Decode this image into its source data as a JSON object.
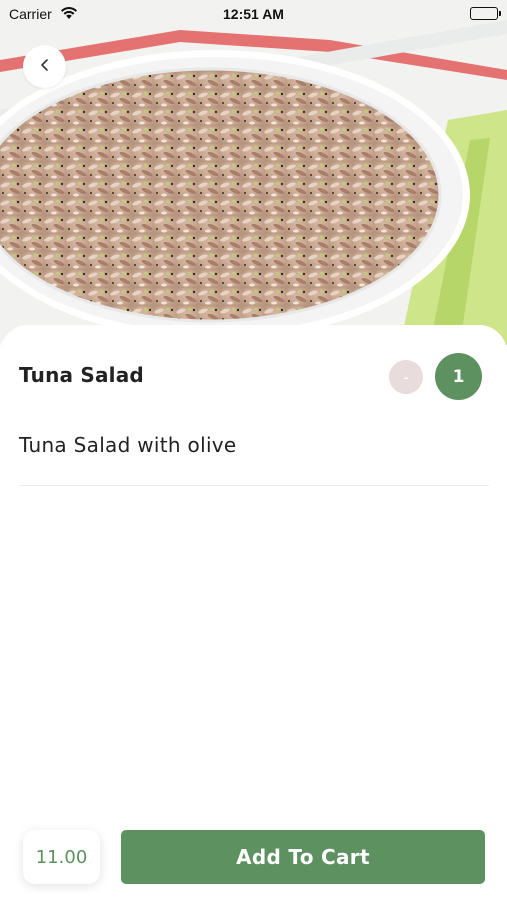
{
  "status_bar": {
    "carrier": "Carrier",
    "time": "12:51 AM",
    "icons": [
      "wifi-icon",
      "battery-icon"
    ]
  },
  "hero": {
    "image": "tuna-salad-bowl-photo",
    "back_icon": "chevron-left-icon"
  },
  "product": {
    "name": "Tuna Salad",
    "description": "Tuna Salad with olive",
    "decrement_label": "-",
    "quantity": "1",
    "price": "11.00"
  },
  "actions": {
    "add_to_cart_label": "Add To Cart"
  },
  "colors": {
    "accent": "#5d9160",
    "decrement_bg": "#e9dcdc",
    "text": "#222222"
  }
}
